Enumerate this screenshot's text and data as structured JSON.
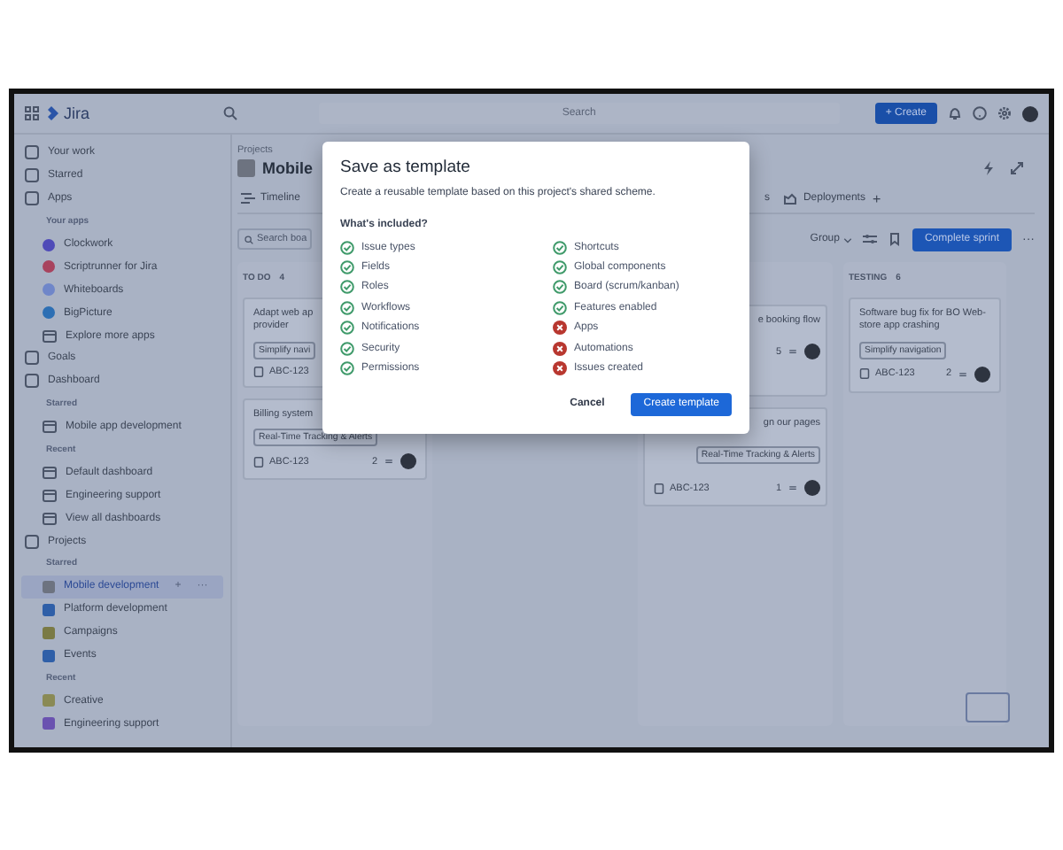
{
  "top_bar": {
    "product": "Jira",
    "search": {
      "placeholder": "Search"
    },
    "create_button": "+ Create"
  },
  "sidebar": {
    "items": [
      {
        "kind": "section",
        "label": "Your work",
        "selected": false
      },
      {
        "kind": "section",
        "label": "Starred",
        "selected": false
      },
      {
        "kind": "section",
        "label": "Apps",
        "selected": false
      },
      {
        "kind": "heading",
        "label": "Your apps",
        "selected": false
      },
      {
        "kind": "app",
        "label": "Clockwork",
        "color": "#4f4bb8",
        "selected": false
      },
      {
        "kind": "app",
        "label": "Scriptrunner for Jira",
        "color": "#a8435e",
        "selected": false
      },
      {
        "kind": "app",
        "label": "Whiteboards",
        "color": "#6f86c9",
        "selected": false
      },
      {
        "kind": "app",
        "label": "BigPicture",
        "color": "#2d6fb4",
        "selected": false
      },
      {
        "kind": "item",
        "label": "Explore more apps",
        "selected": false
      },
      {
        "kind": "section",
        "label": "Goals",
        "selected": false
      },
      {
        "kind": "section",
        "label": "Dashboard",
        "selected": false
      },
      {
        "kind": "heading",
        "label": "Starred",
        "selected": false
      },
      {
        "kind": "item",
        "label": "Mobile app development",
        "selected": false
      },
      {
        "kind": "heading",
        "label": "Recent",
        "selected": false
      },
      {
        "kind": "item",
        "label": "Default dashboard",
        "selected": false
      },
      {
        "kind": "item",
        "label": "Engineering support",
        "selected": false
      },
      {
        "kind": "item",
        "label": "View all dashboards",
        "selected": false
      },
      {
        "kind": "section",
        "label": "Projects",
        "selected": false
      },
      {
        "kind": "heading",
        "label": "Starred",
        "selected": false
      },
      {
        "kind": "project",
        "label": "Mobile development",
        "color": "#6d7380",
        "selected": true,
        "actions": [
          "+",
          "···"
        ]
      },
      {
        "kind": "project",
        "label": "Platform development",
        "color": "#2f5fa8",
        "selected": false
      },
      {
        "kind": "project",
        "label": "Campaigns",
        "color": "#7a7a45",
        "selected": false
      },
      {
        "kind": "project",
        "label": "Events",
        "color": "#2f5fa8",
        "selected": false
      },
      {
        "kind": "heading",
        "label": "Recent",
        "selected": false
      },
      {
        "kind": "project",
        "label": "Creative",
        "color": "#8a8a55",
        "selected": false
      },
      {
        "kind": "project",
        "label": "Engineering support",
        "color": "#6a52b0",
        "selected": false
      }
    ]
  },
  "header": {
    "breadcrumb": "Projects",
    "title": "Mobile",
    "tabs": [
      {
        "label": "Timeline",
        "selected": false
      },
      {
        "label": "s",
        "selected": false
      },
      {
        "label": "Deployments",
        "selected": false
      }
    ],
    "add_tab": "+"
  },
  "toolbar": {
    "search": {
      "placeholder": "Search boa"
    },
    "group": "Group",
    "complete_button": "Complete sprint",
    "more": "···"
  },
  "columns": [
    {
      "kind": "open",
      "title": "TO DO",
      "count": "4",
      "cards": [
        {
          "title_lines": [
            "Adapt web ap",
            "provider"
          ],
          "tag": "Simplify navi",
          "key": "ABC-123"
        },
        {
          "title_lines": [
            "Billing system"
          ],
          "tag": "Real-Time Tracking & Alerts",
          "key": "ABC-123",
          "count": "2",
          "avatar": true
        }
      ]
    },
    {
      "kind": "hidden"
    },
    {
      "kind": "covered",
      "cards": [
        {
          "title_lines": [
            "e booking flow"
          ],
          "count": "5",
          "avatar": true
        },
        {
          "title_lines": [
            "gn our pages"
          ],
          "tag": "Real-Time Tracking & Alerts",
          "key": "ABC-123",
          "count": "1",
          "avatar": true
        }
      ]
    },
    {
      "kind": "open",
      "title": "TESTING",
      "count": "6",
      "cards": [
        {
          "title_lines": [
            "Software bug fix for BO Web-store app crashing"
          ],
          "tag": "Simplify navigation",
          "key": "ABC-123",
          "count": "2",
          "avatar": true
        }
      ]
    }
  ],
  "dialog": {
    "title": "Save as template",
    "description": "Create a reusable template based on this project's shared scheme.",
    "section": "What's included?",
    "items": [
      {
        "label": "Issue types",
        "included": true
      },
      {
        "label": "Fields",
        "included": true
      },
      {
        "label": "Roles",
        "included": true
      },
      {
        "label": "Workflows",
        "included": true
      },
      {
        "label": "Notifications",
        "included": true
      },
      {
        "label": "Security",
        "included": true
      },
      {
        "label": "Permissions",
        "included": true
      },
      {
        "label": "Shortcuts",
        "included": true
      },
      {
        "label": "Global components",
        "included": true
      },
      {
        "label": "Board (scrum/kanban)",
        "included": true
      },
      {
        "label": "Features enabled",
        "included": true
      },
      {
        "label": "Apps",
        "included": false
      },
      {
        "label": "Automations",
        "included": false
      },
      {
        "label": "Issues created",
        "included": false
      }
    ],
    "buttons": [
      {
        "kind": "secondary",
        "label": "Cancel"
      },
      {
        "kind": "primary",
        "label": "Create template"
      }
    ]
  }
}
